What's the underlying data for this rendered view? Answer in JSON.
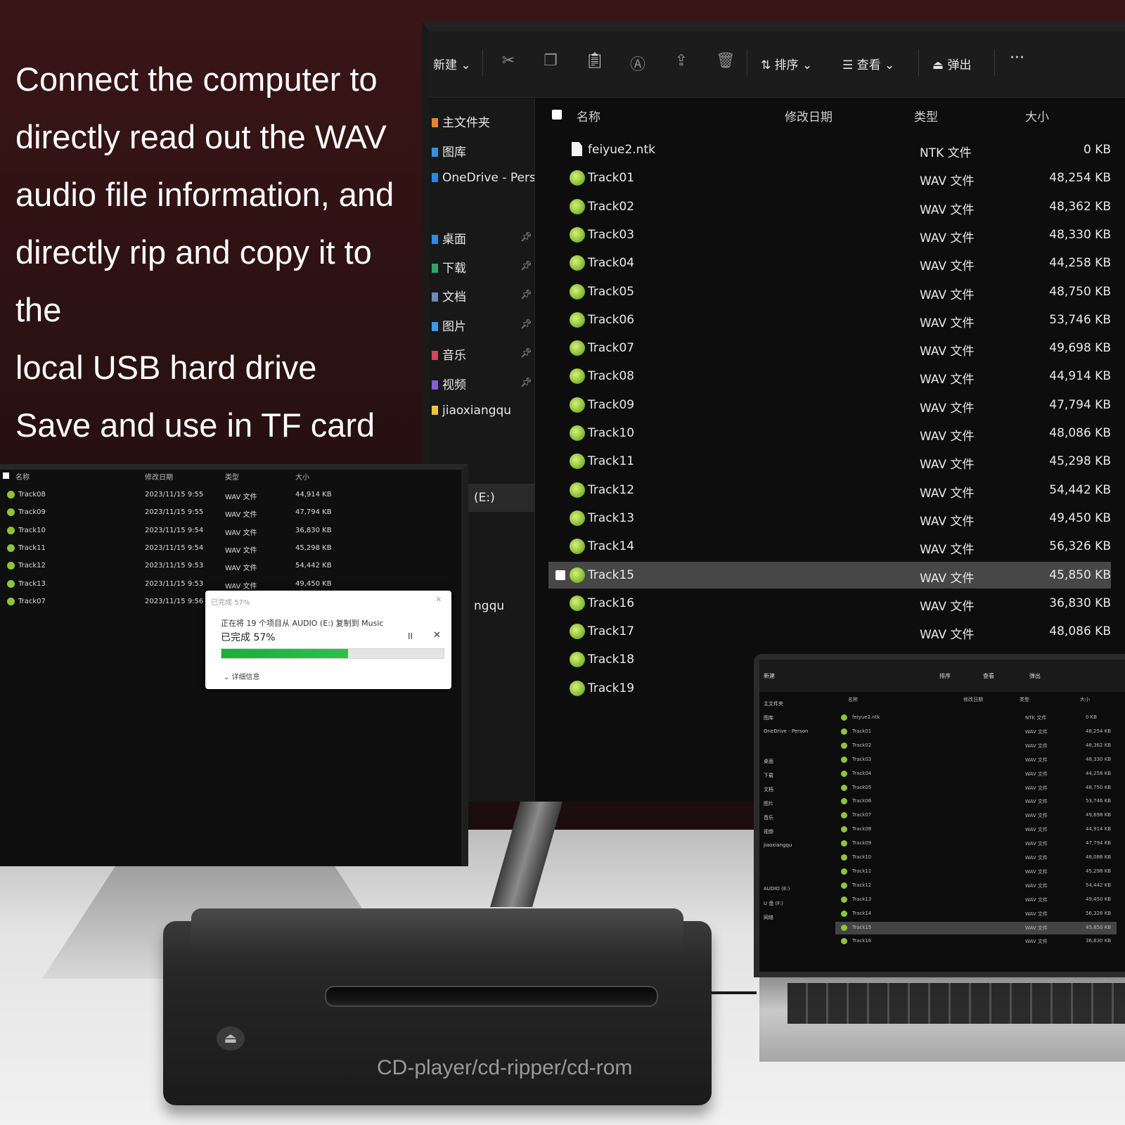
{
  "intro": {
    "lines": [
      "Connect the computer to",
      "directly read out the WAV",
      "audio file information, and",
      "directly rip and copy it to the",
      "local USB hard drive"
    ],
    "tf": "Save and use in TF card"
  },
  "explorer": {
    "toolbar": {
      "new": "新建",
      "sort": "排序",
      "view": "查看",
      "eject": "弹出",
      "more": "···"
    },
    "nav": [
      "主文件夹",
      "图库",
      "OneDrive - Person",
      "桌面",
      "下载",
      "文档",
      "图片",
      "音乐",
      "视频",
      "jiaoxiangqu",
      "(E:)",
      "ngqu"
    ],
    "headers": {
      "name": "名称",
      "date": "修改日期",
      "type": "类型",
      "size": "大小"
    },
    "files": [
      {
        "name": "feiyue2.ntk",
        "type": "NTK 文件",
        "size": "0 KB",
        "kind": "file"
      },
      {
        "name": "Track01",
        "type": "WAV 文件",
        "size": "48,254 KB",
        "kind": "wav"
      },
      {
        "name": "Track02",
        "type": "WAV 文件",
        "size": "48,362 KB",
        "kind": "wav"
      },
      {
        "name": "Track03",
        "type": "WAV 文件",
        "size": "48,330 KB",
        "kind": "wav"
      },
      {
        "name": "Track04",
        "type": "WAV 文件",
        "size": "44,258 KB",
        "kind": "wav"
      },
      {
        "name": "Track05",
        "type": "WAV 文件",
        "size": "48,750 KB",
        "kind": "wav"
      },
      {
        "name": "Track06",
        "type": "WAV 文件",
        "size": "53,746 KB",
        "kind": "wav"
      },
      {
        "name": "Track07",
        "type": "WAV 文件",
        "size": "49,698 KB",
        "kind": "wav"
      },
      {
        "name": "Track08",
        "type": "WAV 文件",
        "size": "44,914 KB",
        "kind": "wav"
      },
      {
        "name": "Track09",
        "type": "WAV 文件",
        "size": "47,794 KB",
        "kind": "wav"
      },
      {
        "name": "Track10",
        "type": "WAV 文件",
        "size": "48,086 KB",
        "kind": "wav"
      },
      {
        "name": "Track11",
        "type": "WAV 文件",
        "size": "45,298 KB",
        "kind": "wav"
      },
      {
        "name": "Track12",
        "type": "WAV 文件",
        "size": "54,442 KB",
        "kind": "wav"
      },
      {
        "name": "Track13",
        "type": "WAV 文件",
        "size": "49,450 KB",
        "kind": "wav"
      },
      {
        "name": "Track14",
        "type": "WAV 文件",
        "size": "56,326 KB",
        "kind": "wav"
      },
      {
        "name": "Track15",
        "type": "WAV 文件",
        "size": "45,850 KB",
        "kind": "wav",
        "selected": true
      },
      {
        "name": "Track16",
        "type": "WAV 文件",
        "size": "36,830 KB",
        "kind": "wav"
      },
      {
        "name": "Track17",
        "type": "WAV 文件",
        "size": "48,086 KB",
        "kind": "wav"
      },
      {
        "name": "Track18",
        "type": "",
        "size": "",
        "kind": "wav"
      },
      {
        "name": "Track19",
        "type": "",
        "size": "",
        "kind": "wav"
      }
    ]
  },
  "front": {
    "headers": {
      "name": "名称",
      "date": "修改日期",
      "type": "类型",
      "size": "大小"
    },
    "rows": [
      {
        "name": "Track08",
        "date": "2023/11/15 9:55",
        "type": "WAV 文件",
        "size": "44,914 KB"
      },
      {
        "name": "Track09",
        "date": "2023/11/15 9:55",
        "type": "WAV 文件",
        "size": "47,794 KB"
      },
      {
        "name": "Track10",
        "date": "2023/11/15 9:54",
        "type": "WAV 文件",
        "size": "36,830 KB"
      },
      {
        "name": "Track11",
        "date": "2023/11/15 9:54",
        "type": "WAV 文件",
        "size": "45,298 KB"
      },
      {
        "name": "Track12",
        "date": "2023/11/15 9:53",
        "type": "WAV 文件",
        "size": "54,442 KB"
      },
      {
        "name": "Track13",
        "date": "2023/11/15 9:53",
        "type": "WAV 文件",
        "size": "49,450 KB"
      },
      {
        "name": "Track07",
        "date": "2023/11/15 9:56",
        "type": "",
        "size": ""
      }
    ],
    "dialog": {
      "title": "已完成 57%",
      "message": "正在将 19 个项目从 AUDIO (E:) 复制到 Music",
      "done": "已完成 57%",
      "progress": 0.57,
      "pause": "II",
      "close": "✕",
      "details": "⌄  详细信息",
      "title_close": "✕"
    }
  },
  "laptop": {
    "toolbar": {
      "new": "新建",
      "sort": "排序",
      "view": "查看",
      "eject": "弹出"
    },
    "headers": {
      "name": "名称",
      "date": "修改日期",
      "type": "类型",
      "size": "大小"
    },
    "nav": [
      "主文件夹",
      "图库",
      "OneDrive - Person",
      "桌面",
      "下载",
      "文档",
      "图片",
      "音乐",
      "视频",
      "jiaoxiangqu",
      "AUDIO (E:)",
      "U 盘 (F:)",
      "网络"
    ],
    "rows": [
      {
        "name": "feiyue2.ntk",
        "type": "NTK 文件",
        "size": "0 KB"
      },
      {
        "name": "Track01",
        "type": "WAV 文件",
        "size": "48,254 KB"
      },
      {
        "name": "Track02",
        "type": "WAV 文件",
        "size": "48,362 KB"
      },
      {
        "name": "Track03",
        "type": "WAV 文件",
        "size": "48,330 KB"
      },
      {
        "name": "Track04",
        "type": "WAV 文件",
        "size": "44,258 KB"
      },
      {
        "name": "Track05",
        "type": "WAV 文件",
        "size": "48,750 KB"
      },
      {
        "name": "Track06",
        "type": "WAV 文件",
        "size": "53,746 KB"
      },
      {
        "name": "Track07",
        "type": "WAV 文件",
        "size": "49,698 KB"
      },
      {
        "name": "Track08",
        "type": "WAV 文件",
        "size": "44,914 KB"
      },
      {
        "name": "Track09",
        "type": "WAV 文件",
        "size": "47,794 KB"
      },
      {
        "name": "Track10",
        "type": "WAV 文件",
        "size": "48,086 KB"
      },
      {
        "name": "Track11",
        "type": "WAV 文件",
        "size": "45,298 KB"
      },
      {
        "name": "Track12",
        "type": "WAV 文件",
        "size": "54,442 KB"
      },
      {
        "name": "Track13",
        "type": "WAV 文件",
        "size": "49,450 KB"
      },
      {
        "name": "Track14",
        "type": "WAV 文件",
        "size": "56,326 KB"
      },
      {
        "name": "Track15",
        "type": "WAV 文件",
        "size": "45,850 KB",
        "selected": true
      },
      {
        "name": "Track16",
        "type": "WAV 文件",
        "size": "36,830 KB"
      }
    ]
  },
  "device": {
    "label": "CD-player/cd-ripper/cd-rom",
    "eject_icon": "eject-icon"
  },
  "colors": {
    "wav_icon": "#8fc43a",
    "progress": "#1aae3a",
    "selected_row": "#474747"
  }
}
